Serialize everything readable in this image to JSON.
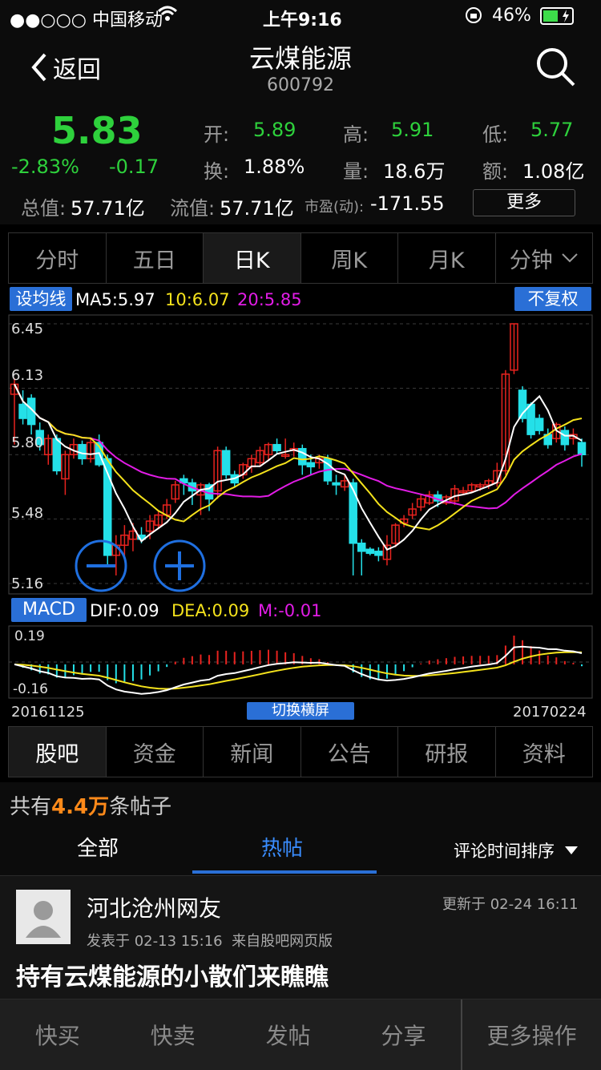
{
  "status": {
    "carrier": "●●○○○ 中国移动",
    "time": "上午9:16",
    "battery": "46%"
  },
  "nav": {
    "back": "返回",
    "title": "云煤能源",
    "code": "600792"
  },
  "quote": {
    "price": "5.83",
    "pct": "-2.83%",
    "change": "-0.17",
    "open_label": "开:",
    "open": "5.89",
    "high_label": "高:",
    "high": "5.91",
    "low_label": "低:",
    "low": "5.77",
    "turn_label": "换:",
    "turn": "1.88%",
    "vol_label": "量:",
    "vol": "18.6万",
    "amt_label": "额:",
    "amt": "1.08亿",
    "mcap_label": "总值:",
    "mcap": "57.71亿",
    "float_label": "流值:",
    "float": "57.71亿",
    "pe_label": "市盈(动):",
    "pe": "-171.55",
    "more": "更多"
  },
  "chart_tabs": [
    "分时",
    "五日",
    "日K",
    "周K",
    "月K",
    "分钟"
  ],
  "ma": {
    "btn": "设均线",
    "ma5": "MA5:5.97",
    "ma10": "10:6.07",
    "ma20": "20:5.85",
    "fq": "不复权"
  },
  "macd": {
    "btn": "MACD",
    "dif": "DIF:0.09",
    "dea": "DEA:0.09",
    "m": "M:-0.01"
  },
  "axis": {
    "p1": "6.45",
    "p2": "6.13",
    "p3": "5.80",
    "p4": "5.48",
    "p5": "5.16",
    "m_top": "0.19",
    "m_bot": "-0.16",
    "d_start": "20161125",
    "d_end": "20170224",
    "landscape": "切换横屏"
  },
  "colors": {
    "up": "#e8231f",
    "down": "#24e0e8",
    "ma5": "#ffffff",
    "ma10": "#f4e21c",
    "ma20": "#e21ce6",
    "accent": "#2a6fd6"
  },
  "chart_data": {
    "type": "candlestick",
    "x": [
      "20161125",
      "20170224"
    ],
    "ylim": [
      5.16,
      6.45
    ],
    "ma_labels": {
      "MA5": 5.97,
      "MA10": 6.07,
      "MA20": 5.85
    },
    "candles": [
      [
        6.1,
        6.15,
        5.85,
        6.18
      ],
      [
        6.05,
        5.98,
        5.95,
        6.12
      ],
      [
        6.08,
        5.95,
        5.9,
        6.1
      ],
      [
        5.92,
        5.85,
        5.82,
        5.96
      ],
      [
        5.8,
        5.88,
        5.75,
        5.9
      ],
      [
        5.88,
        5.72,
        5.7,
        5.9
      ],
      [
        5.68,
        5.8,
        5.6,
        5.82
      ],
      [
        5.8,
        5.85,
        5.78,
        5.88
      ],
      [
        5.85,
        5.78,
        5.75,
        5.87
      ],
      [
        5.78,
        5.86,
        5.76,
        5.88
      ],
      [
        5.86,
        5.75,
        5.74,
        5.9
      ],
      [
        5.78,
        5.3,
        5.25,
        5.8
      ],
      [
        5.3,
        5.35,
        5.2,
        5.4
      ],
      [
        5.35,
        5.4,
        5.28,
        5.45
      ],
      [
        5.38,
        5.42,
        5.32,
        5.46
      ],
      [
        5.4,
        5.38,
        5.36,
        5.44
      ],
      [
        5.42,
        5.47,
        5.38,
        5.5
      ],
      [
        5.45,
        5.5,
        5.43,
        5.52
      ],
      [
        5.5,
        5.55,
        5.48,
        5.58
      ],
      [
        5.58,
        5.65,
        5.56,
        5.67
      ],
      [
        5.68,
        5.66,
        5.6,
        5.7
      ],
      [
        5.66,
        5.62,
        5.55,
        5.68
      ],
      [
        5.6,
        5.65,
        5.5,
        5.66
      ],
      [
        5.65,
        5.58,
        5.52,
        5.66
      ],
      [
        5.62,
        5.82,
        5.58,
        5.84
      ],
      [
        5.82,
        5.7,
        5.68,
        5.84
      ],
      [
        5.7,
        5.66,
        5.64,
        5.72
      ],
      [
        5.7,
        5.75,
        5.68,
        5.76
      ],
      [
        5.74,
        5.78,
        5.71,
        5.8
      ],
      [
        5.76,
        5.82,
        5.74,
        5.84
      ],
      [
        5.8,
        5.85,
        5.77,
        5.86
      ],
      [
        5.85,
        5.82,
        5.8,
        5.88
      ],
      [
        5.8,
        5.8,
        5.78,
        5.88
      ],
      [
        5.82,
        5.83,
        5.79,
        5.86
      ],
      [
        5.83,
        5.75,
        5.7,
        5.85
      ],
      [
        5.76,
        5.74,
        5.7,
        5.8
      ],
      [
        5.76,
        5.78,
        5.73,
        5.8
      ],
      [
        5.78,
        5.67,
        5.65,
        5.8
      ],
      [
        5.66,
        5.65,
        5.6,
        5.7
      ],
      [
        5.64,
        5.67,
        5.62,
        5.7
      ],
      [
        5.66,
        5.36,
        5.2,
        5.68
      ],
      [
        5.36,
        5.32,
        5.2,
        5.38
      ],
      [
        5.33,
        5.31,
        5.3,
        5.34
      ],
      [
        5.32,
        5.3,
        5.27,
        5.34
      ],
      [
        5.28,
        5.35,
        5.25,
        5.4
      ],
      [
        5.36,
        5.45,
        5.34,
        5.46
      ],
      [
        5.46,
        5.48,
        5.44,
        5.5
      ],
      [
        5.5,
        5.53,
        5.48,
        5.56
      ],
      [
        5.54,
        5.58,
        5.52,
        5.6
      ],
      [
        5.56,
        5.6,
        5.55,
        5.62
      ],
      [
        5.6,
        5.57,
        5.54,
        5.62
      ],
      [
        5.56,
        5.59,
        5.55,
        5.6
      ],
      [
        5.57,
        5.63,
        5.55,
        5.65
      ],
      [
        5.62,
        5.62,
        5.6,
        5.64
      ],
      [
        5.62,
        5.65,
        5.61,
        5.66
      ],
      [
        5.64,
        5.65,
        5.62,
        5.66
      ],
      [
        5.65,
        5.67,
        5.63,
        5.68
      ],
      [
        5.66,
        5.72,
        5.64,
        5.76
      ],
      [
        5.72,
        6.2,
        5.7,
        6.22
      ],
      [
        6.22,
        6.45,
        6.2,
        6.45
      ],
      [
        6.12,
        5.98,
        5.96,
        6.14
      ],
      [
        6.05,
        5.9,
        5.88,
        6.06
      ],
      [
        5.98,
        5.92,
        5.9,
        6.0
      ],
      [
        5.9,
        5.85,
        5.83,
        5.93
      ],
      [
        5.88,
        5.95,
        5.86,
        5.96
      ],
      [
        5.92,
        5.85,
        5.82,
        5.94
      ],
      [
        5.88,
        5.9,
        5.85,
        5.93
      ],
      [
        5.86,
        5.8,
        5.74,
        5.88
      ]
    ],
    "macd": {
      "ylim": [
        -0.16,
        0.19
      ],
      "dif_end": 0.09,
      "dea_end": 0.09,
      "m_end": -0.01
    }
  },
  "forum_tabs": [
    "股吧",
    "资金",
    "新闻",
    "公告",
    "研报",
    "资料"
  ],
  "posts": {
    "prefix": "共有",
    "count": "4.4万",
    "suffix": "条帖子",
    "tab_all": "全部",
    "tab_hot": "热帖",
    "sort": "评论时间排序"
  },
  "post": {
    "author": "河北沧州网友",
    "updated": "更新于 02-24 16:11",
    "meta": "发表于 02-13 15:16  来自股吧网页版",
    "title": "持有云煤能源的小散们来瞧瞧"
  },
  "bottom": [
    "快买",
    "快卖",
    "发帖",
    "分享",
    "更多操作"
  ]
}
